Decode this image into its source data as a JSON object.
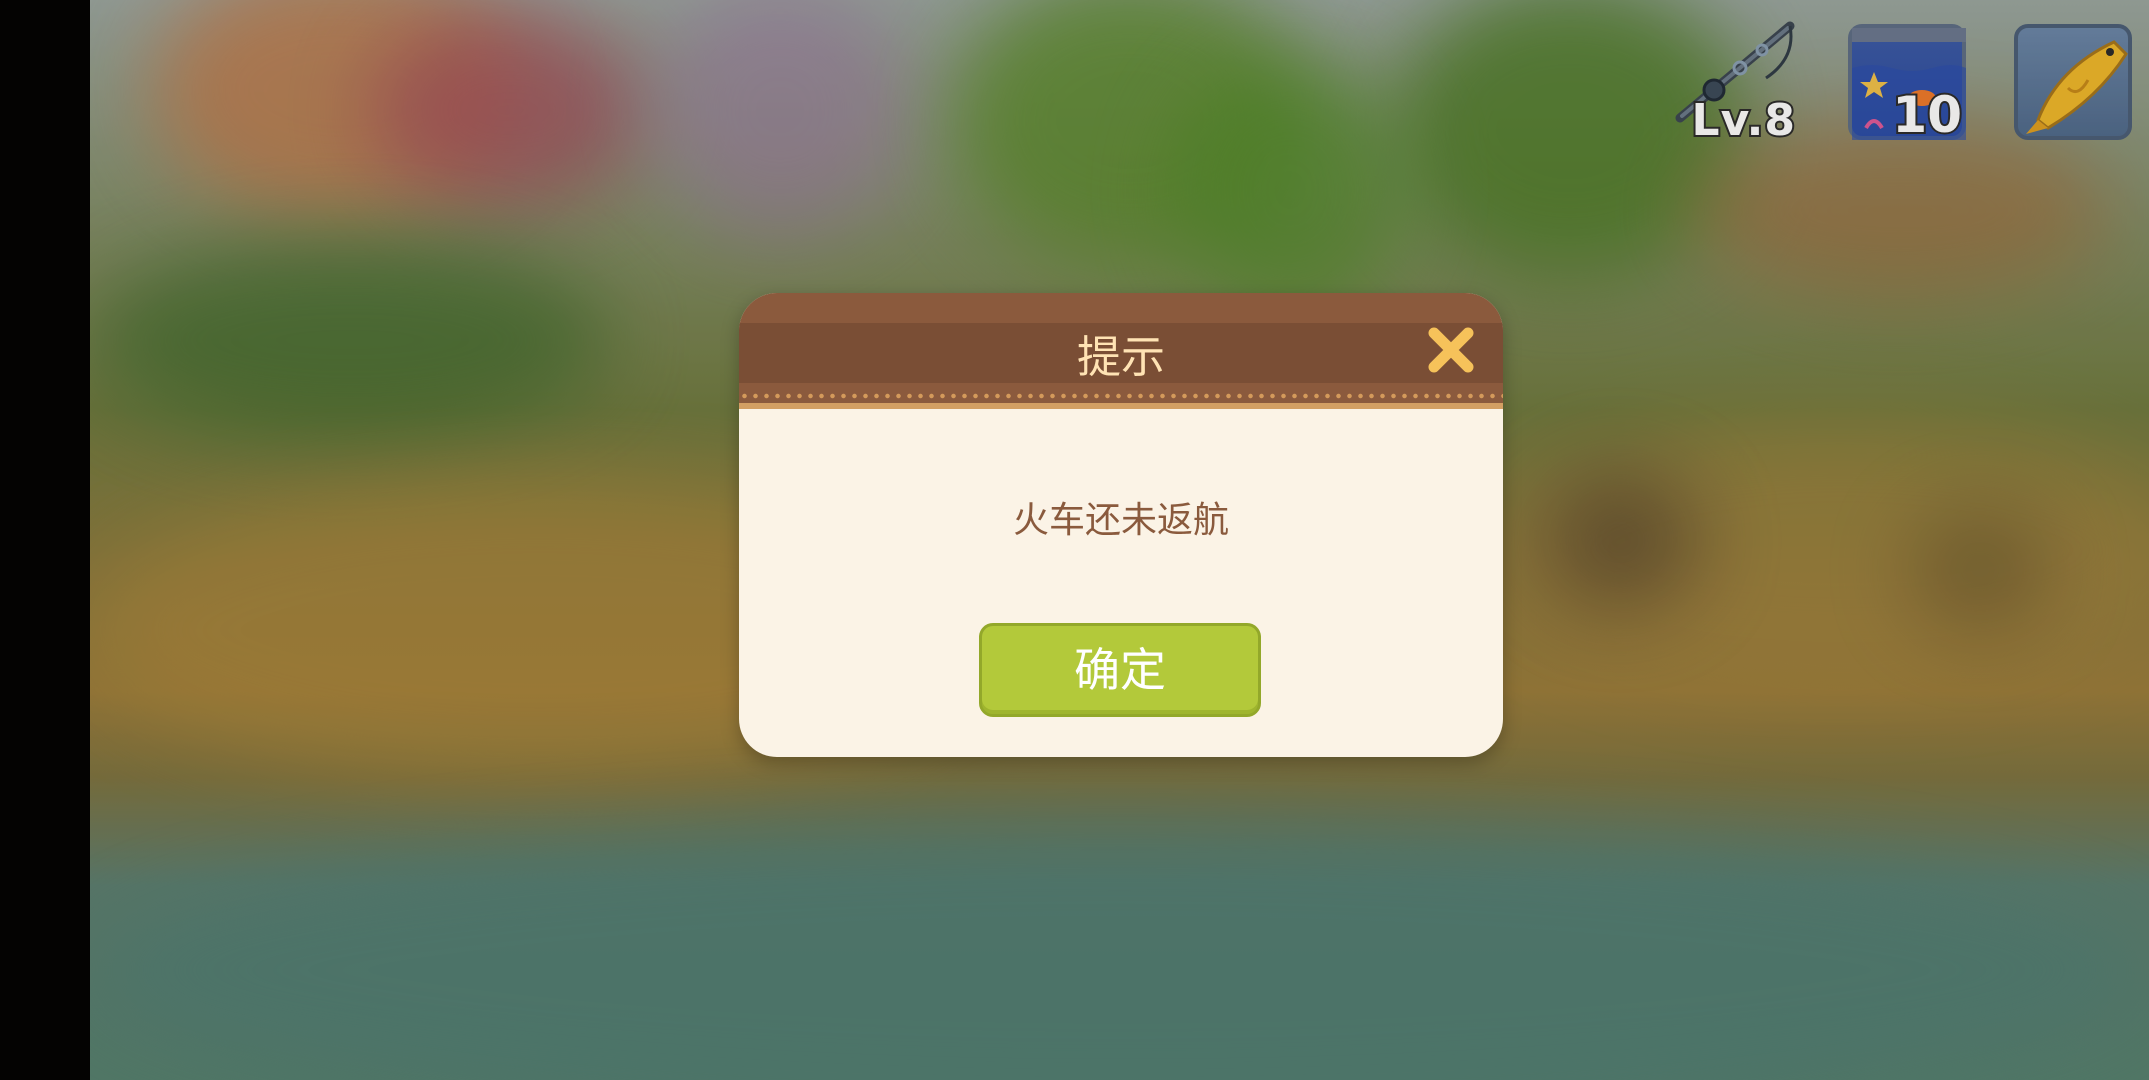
{
  "hud": {
    "rod_level": "Lv.8",
    "aquarium_count": "10",
    "icons": {
      "rod": "fishing-rod-icon",
      "aquarium": "aquarium-icon",
      "fish": "fish-icon"
    }
  },
  "dialog": {
    "title": "提示",
    "message": "火车还未返航",
    "confirm_label": "确定",
    "close_icon": "close-icon"
  },
  "colors": {
    "header": "#7a4e35",
    "title_text": "#ffe3b4",
    "body": "#fbf3e6",
    "message_text": "#8a5a3d",
    "confirm_button": "#b3c93a",
    "close_icon": "#f6c25a"
  }
}
